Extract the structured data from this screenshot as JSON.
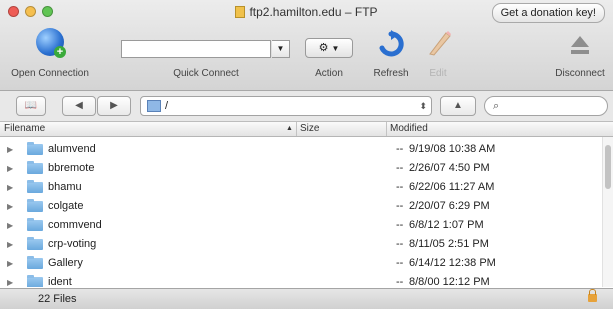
{
  "window": {
    "title": "ftp2.hamilton.edu – FTP",
    "donation_button": "Get a donation key!"
  },
  "toolbar": {
    "open_connection": "Open Connection",
    "quick_connect": "Quick Connect",
    "quick_connect_value": "",
    "action": "Action",
    "refresh": "Refresh",
    "edit": "Edit",
    "disconnect": "Disconnect"
  },
  "navigation": {
    "bookmarks_glyph": "📖",
    "back_glyph": "◀",
    "forward_glyph": "▶",
    "path": "/",
    "up_glyph": "▲",
    "search_placeholder": "",
    "search_glyph": "⌕"
  },
  "columns": {
    "filename": "Filename",
    "size": "Size",
    "modified": "Modified",
    "sort_indicator": "▲"
  },
  "files": [
    {
      "name": "alumvend",
      "size": "--",
      "modified": "9/19/08 10:38 AM"
    },
    {
      "name": "bbremote",
      "size": "--",
      "modified": "2/26/07 4:50 PM"
    },
    {
      "name": "bhamu",
      "size": "--",
      "modified": "6/22/06 11:27 AM"
    },
    {
      "name": "colgate",
      "size": "--",
      "modified": "2/20/07 6:29 PM"
    },
    {
      "name": "commvend",
      "size": "--",
      "modified": "6/8/12 1:07 PM"
    },
    {
      "name": "crp-voting",
      "size": "--",
      "modified": "8/11/05 2:51 PM"
    },
    {
      "name": "Gallery",
      "size": "--",
      "modified": "6/14/12 12:38 PM"
    },
    {
      "name": "ident",
      "size": "--",
      "modified": "8/8/00 12:12 PM"
    }
  ],
  "status": {
    "file_count": "22 Files"
  },
  "icons": {
    "open_connection": "globe-icon",
    "refresh": "refresh-icon",
    "edit": "pencil-icon",
    "disconnect": "eject-icon",
    "status_lock": "lock-icon"
  },
  "colors": {
    "folder": "#6aa8dd",
    "refresh": "#2a6fd0"
  }
}
